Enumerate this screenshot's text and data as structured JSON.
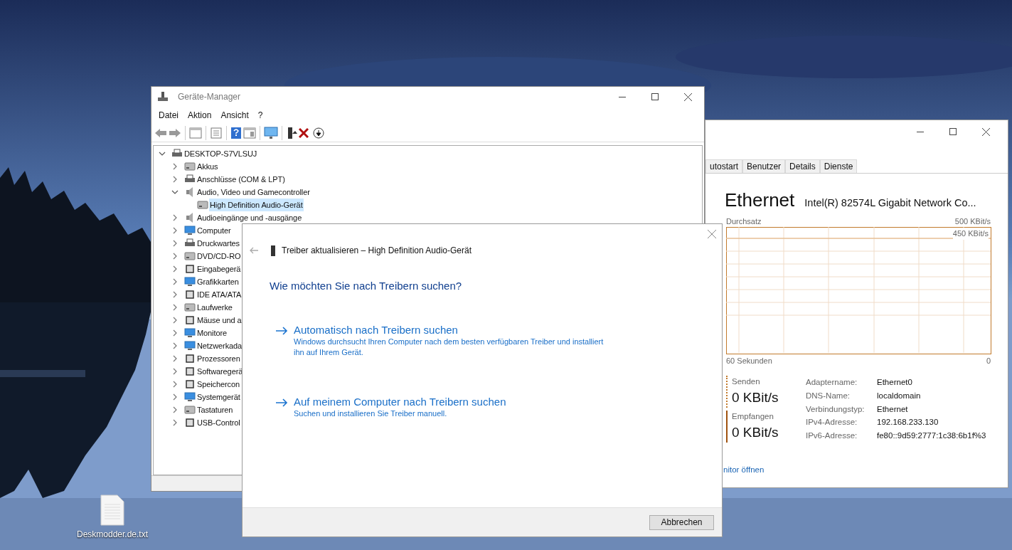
{
  "desktop": {
    "icons": [
      {
        "label": "Deskmodder.de.txt"
      }
    ]
  },
  "device_manager": {
    "title": "Geräte-Manager",
    "menu": [
      "Datei",
      "Aktion",
      "Ansicht",
      "?"
    ],
    "tree": [
      {
        "label": "DESKTOP-S7VLSUJ",
        "expanded": true,
        "selected": false,
        "children": [
          {
            "label": "Akkus",
            "expanded": false,
            "selected": false
          },
          {
            "label": "Anschlüsse (COM & LPT)",
            "expanded": false,
            "selected": false
          },
          {
            "label": "Audio, Video und Gamecontroller",
            "expanded": true,
            "selected": false,
            "children": [
              {
                "label": "High Definition Audio-Gerät",
                "selected": true
              }
            ]
          },
          {
            "label": "Audioeingänge und -ausgänge",
            "expanded": false,
            "selected": false
          },
          {
            "label": "Computer",
            "expanded": false,
            "selected": false
          },
          {
            "label": "Druckwartes",
            "expanded": false,
            "selected": false
          },
          {
            "label": "DVD/CD-RO",
            "expanded": false,
            "selected": false
          },
          {
            "label": "Eingabegerä",
            "expanded": false,
            "selected": false
          },
          {
            "label": "Grafikkarten",
            "expanded": false,
            "selected": false
          },
          {
            "label": "IDE ATA/ATA",
            "expanded": false,
            "selected": false
          },
          {
            "label": "Laufwerke",
            "expanded": false,
            "selected": false
          },
          {
            "label": "Mäuse und a",
            "expanded": false,
            "selected": false
          },
          {
            "label": "Monitore",
            "expanded": false,
            "selected": false
          },
          {
            "label": "Netzwerkada",
            "expanded": false,
            "selected": false
          },
          {
            "label": "Prozessoren",
            "expanded": false,
            "selected": false
          },
          {
            "label": "Softwaregerä",
            "expanded": false,
            "selected": false
          },
          {
            "label": "Speichercon",
            "expanded": false,
            "selected": false
          },
          {
            "label": "Systemgerät",
            "expanded": false,
            "selected": false
          },
          {
            "label": "Tastaturen",
            "expanded": false,
            "selected": false
          },
          {
            "label": "USB-Control",
            "expanded": false,
            "selected": false
          }
        ]
      }
    ]
  },
  "task_manager": {
    "tabs": [
      {
        "label": "utostart",
        "selected": false
      },
      {
        "label": "Benutzer",
        "selected": false
      },
      {
        "label": "Details",
        "selected": false
      },
      {
        "label": "Dienste",
        "selected": false
      }
    ],
    "heading": "Ethernet",
    "adapter": "Intel(R) 82574L Gigabit Network Co...",
    "graph": {
      "title": "Durchsatz",
      "max_label": "500 KBit/s",
      "scale_label": "450 KBit/s",
      "time_label": "60 Sekunden",
      "end_label": "0"
    },
    "send": {
      "label": "Senden",
      "value": "0 KBit/s"
    },
    "receive": {
      "label": "Empfangen",
      "value": "0 KBit/s"
    },
    "properties": [
      {
        "name": "Adaptername:",
        "value": "Ethernet0"
      },
      {
        "name": "DNS-Name:",
        "value": "localdomain"
      },
      {
        "name": "Verbindungstyp:",
        "value": "Ethernet"
      },
      {
        "name": "IPv4-Adresse:",
        "value": "192.168.233.130"
      },
      {
        "name": "IPv6-Adresse:",
        "value": "fe80::9d59:2777:1c38:6b1f%3"
      }
    ],
    "link": "nitor öffnen"
  },
  "dialog": {
    "title": "Treiber aktualisieren – High Definition Audio-Gerät",
    "question": "Wie möchten Sie nach Treibern suchen?",
    "options": [
      {
        "title": "Automatisch nach Treibern suchen",
        "description": "Windows durchsucht Ihren Computer nach dem besten verfügbaren Treiber und installiert ihn auf Ihrem Gerät."
      },
      {
        "title": "Auf meinem Computer nach Treibern suchen",
        "description": "Suchen und installieren Sie Treiber manuell."
      }
    ],
    "cancel": "Abbrechen"
  }
}
